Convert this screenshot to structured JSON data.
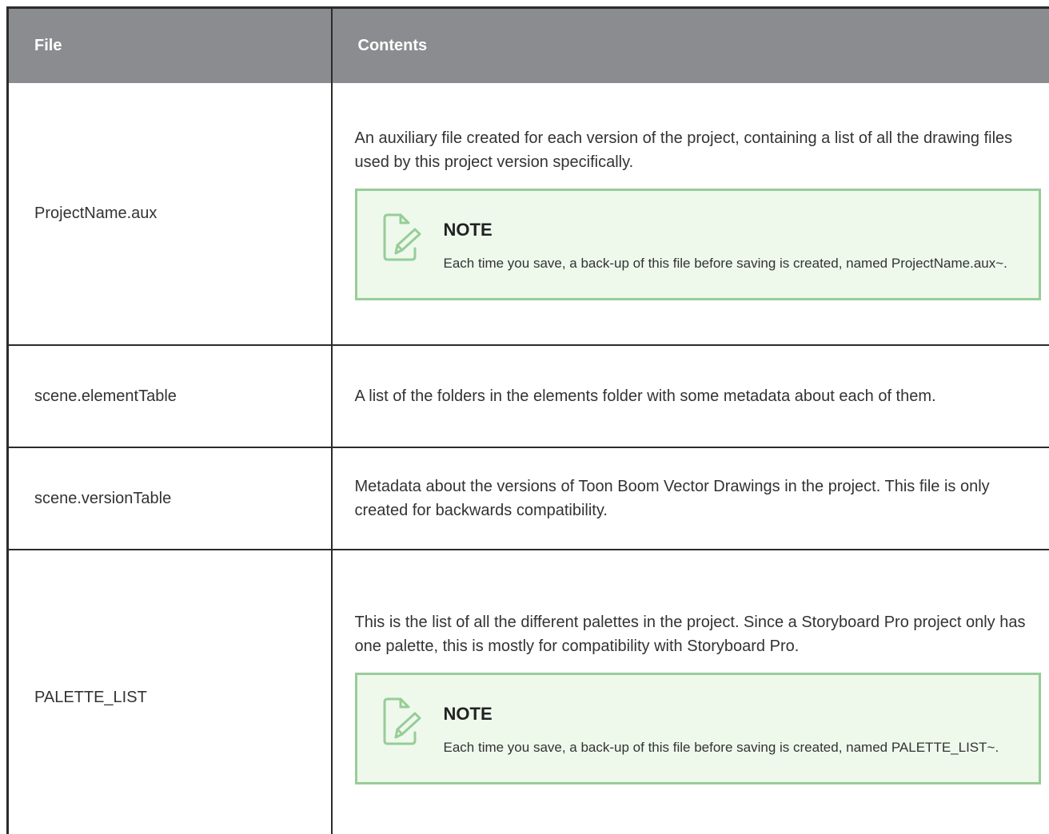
{
  "table": {
    "headers": {
      "file": "File",
      "contents": "Contents"
    },
    "rows": [
      {
        "file": "ProjectName.aux",
        "description": "An auxiliary file created for each version of the project, containing a list of all the drawing files used by this project version specifically.",
        "note": {
          "title": "NOTE",
          "text": "Each time you save, a back-up of this file before saving is created, named ProjectName.aux~."
        }
      },
      {
        "file": "scene.elementTable",
        "description": "A list of the folders in the elements folder with some metadata about each of them."
      },
      {
        "file": "scene.versionTable",
        "description": "Metadata about the versions of Toon Boom Vector Drawings in the project. This file is only created for backwards compatibility."
      },
      {
        "file": "PALETTE_LIST",
        "description": "This is the list of all the different palettes in the project. Since a Storyboard Pro project only has one palette, this is mostly for compatibility with Storyboard Pro.",
        "note": {
          "title": "NOTE",
          "text": "Each time you save, a back-up of this file before saving is created, named PALETTE_LIST~."
        }
      }
    ]
  },
  "icons": {
    "note": "note-pencil-icon"
  },
  "colors": {
    "header_bg": "#8b8c8f",
    "note_bg": "#eef9ec",
    "note_border": "#97cd98",
    "rule": "#2b2b2b"
  }
}
